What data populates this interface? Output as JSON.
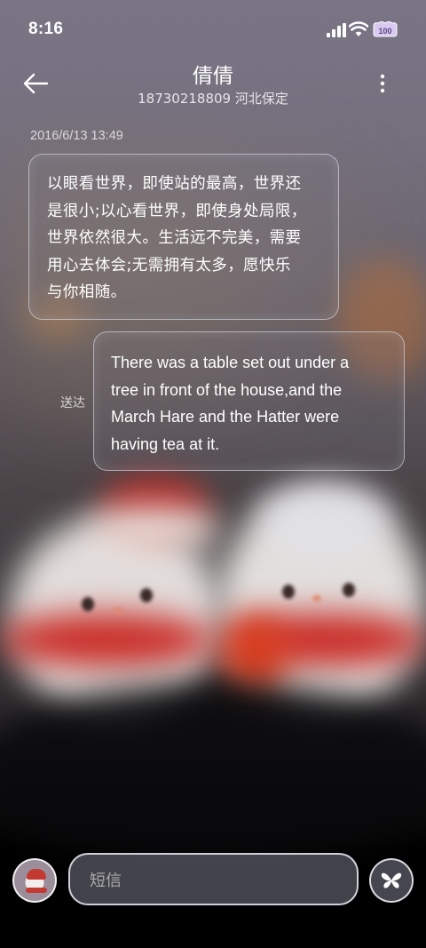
{
  "status_bar": {
    "time": "8:16",
    "battery_label": "100"
  },
  "header": {
    "title": "倩倩",
    "subtitle": "18730218809 河北保定"
  },
  "conversation": {
    "timestamp": "2016/6/13 13:49",
    "messages": [
      {
        "direction": "incoming",
        "lines": [
          "以眼看世界，即使站的最高，世界还",
          "是很小;以心看世界，即使身处局限，",
          "世界依然很大。生活远不完美，需要",
          "用心去体会;无需拥有太多，愿快乐",
          "与你相随。"
        ]
      },
      {
        "direction": "outgoing",
        "lines": [
          "There was a table set out under a",
          "tree in front of the house,and the",
          "March Hare and the Hatter were",
          "having tea at it."
        ],
        "status": "送达"
      }
    ]
  },
  "composer": {
    "placeholder": "短信"
  },
  "icons": {
    "back": "arrow-left-icon",
    "more": "more-vertical-icon",
    "send": "butterfly-send-icon",
    "signal": "signal-icon",
    "wifi": "wifi-icon",
    "battery": "battery-icon"
  }
}
